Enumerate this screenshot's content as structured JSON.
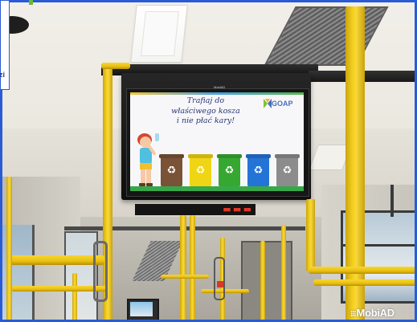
{
  "photo": {
    "subject": "Tram interior with a ceiling-mounted advertising display",
    "colors": {
      "frame_blue": "#2a5bd7",
      "pole_yellow": "#efc419",
      "led_red": "#e23a26"
    }
  },
  "screen": {
    "brand_label": "MobiAD",
    "slogan_lines": [
      "Trafiaj do",
      "właściwego kosza",
      "i nie płać kary!"
    ],
    "logo_text": "GOAP",
    "bins": [
      {
        "color": "#7a5236",
        "icon": "recycle-icon"
      },
      {
        "color": "#f0d515",
        "icon": "recycle-icon"
      },
      {
        "color": "#36a832",
        "icon": "recycle-icon"
      },
      {
        "color": "#2473d6",
        "icon": "recycle-icon"
      },
      {
        "color": "#8c8c8c",
        "icon": "recycle-icon"
      }
    ],
    "recycle_symbol": "♻"
  },
  "led_display": {
    "text": "■■ ■■ ■■"
  },
  "edge_fragment": "zi",
  "watermark": {
    "dots": "⁝⁝⁝",
    "text": "MobiAD"
  }
}
